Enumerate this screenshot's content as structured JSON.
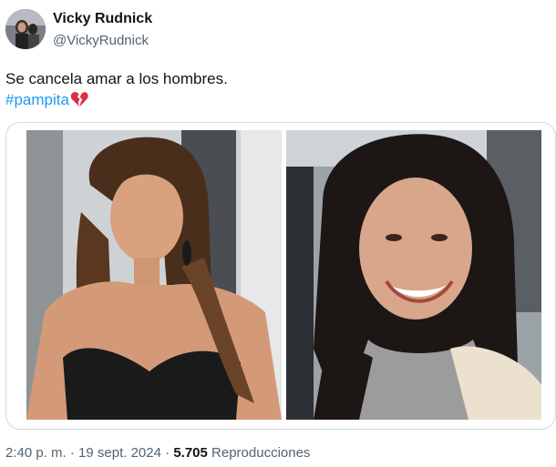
{
  "author": {
    "display_name": "Vicky Rudnick",
    "handle": "@VickyRudnick",
    "avatar_icon": "profile-photo"
  },
  "tweet": {
    "text": "Se cancela amar a los hombres.",
    "hashtag": "#pampita",
    "emoji": "broken-heart",
    "hashtag_color": "#1d9bf0"
  },
  "media": {
    "images": [
      {
        "name": "photo-woman-long-hair-dark-top"
      },
      {
        "name": "photo-woman-smiling-grey-sweater"
      }
    ]
  },
  "meta": {
    "time": "2:40 p. m.",
    "separator": " · ",
    "date": "19 sept. 2024",
    "views_count": "5.705",
    "views_label": "Reproducciones"
  }
}
